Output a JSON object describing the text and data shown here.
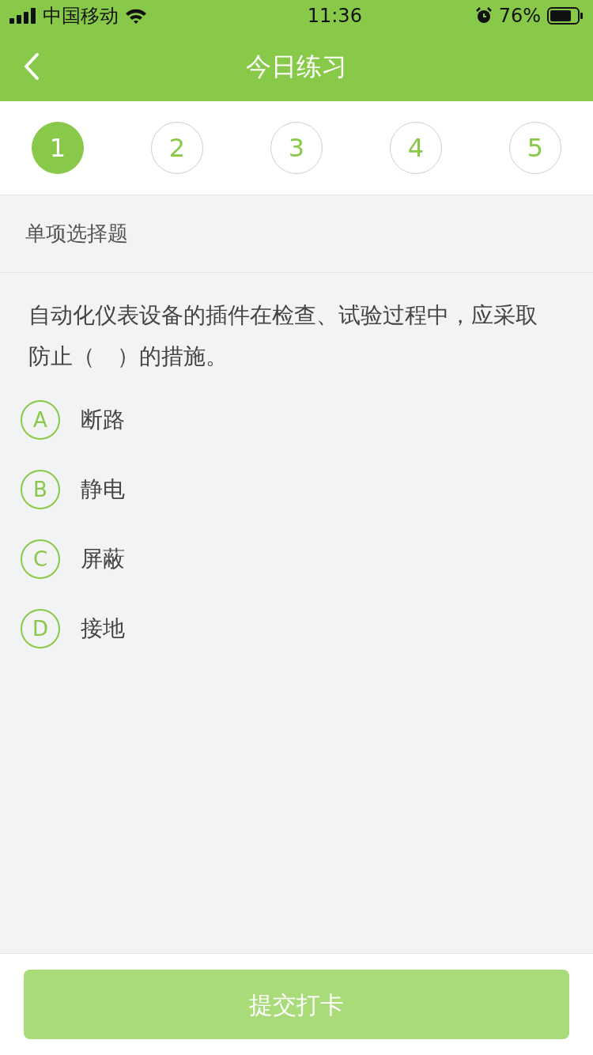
{
  "status_bar": {
    "carrier": "中国移动",
    "time": "11:36",
    "battery": "76%"
  },
  "nav": {
    "title": "今日练习"
  },
  "steps": [
    {
      "label": "1",
      "selected": true
    },
    {
      "label": "2",
      "selected": false
    },
    {
      "label": "3",
      "selected": false
    },
    {
      "label": "4",
      "selected": false
    },
    {
      "label": "5",
      "selected": false
    }
  ],
  "question": {
    "type": "单项选择题",
    "text": "自动化仪表设备的插件在检查、试验过程中，应采取防止（　）的措施。",
    "options": [
      {
        "letter": "A",
        "text": "断路",
        "selected": false
      },
      {
        "letter": "B",
        "text": "静电",
        "selected": false
      },
      {
        "letter": "C",
        "text": "屏蔽",
        "selected": false
      },
      {
        "letter": "D",
        "text": "接地",
        "selected": false
      }
    ]
  },
  "submit": {
    "label": "提交打卡",
    "disabled": true
  }
}
